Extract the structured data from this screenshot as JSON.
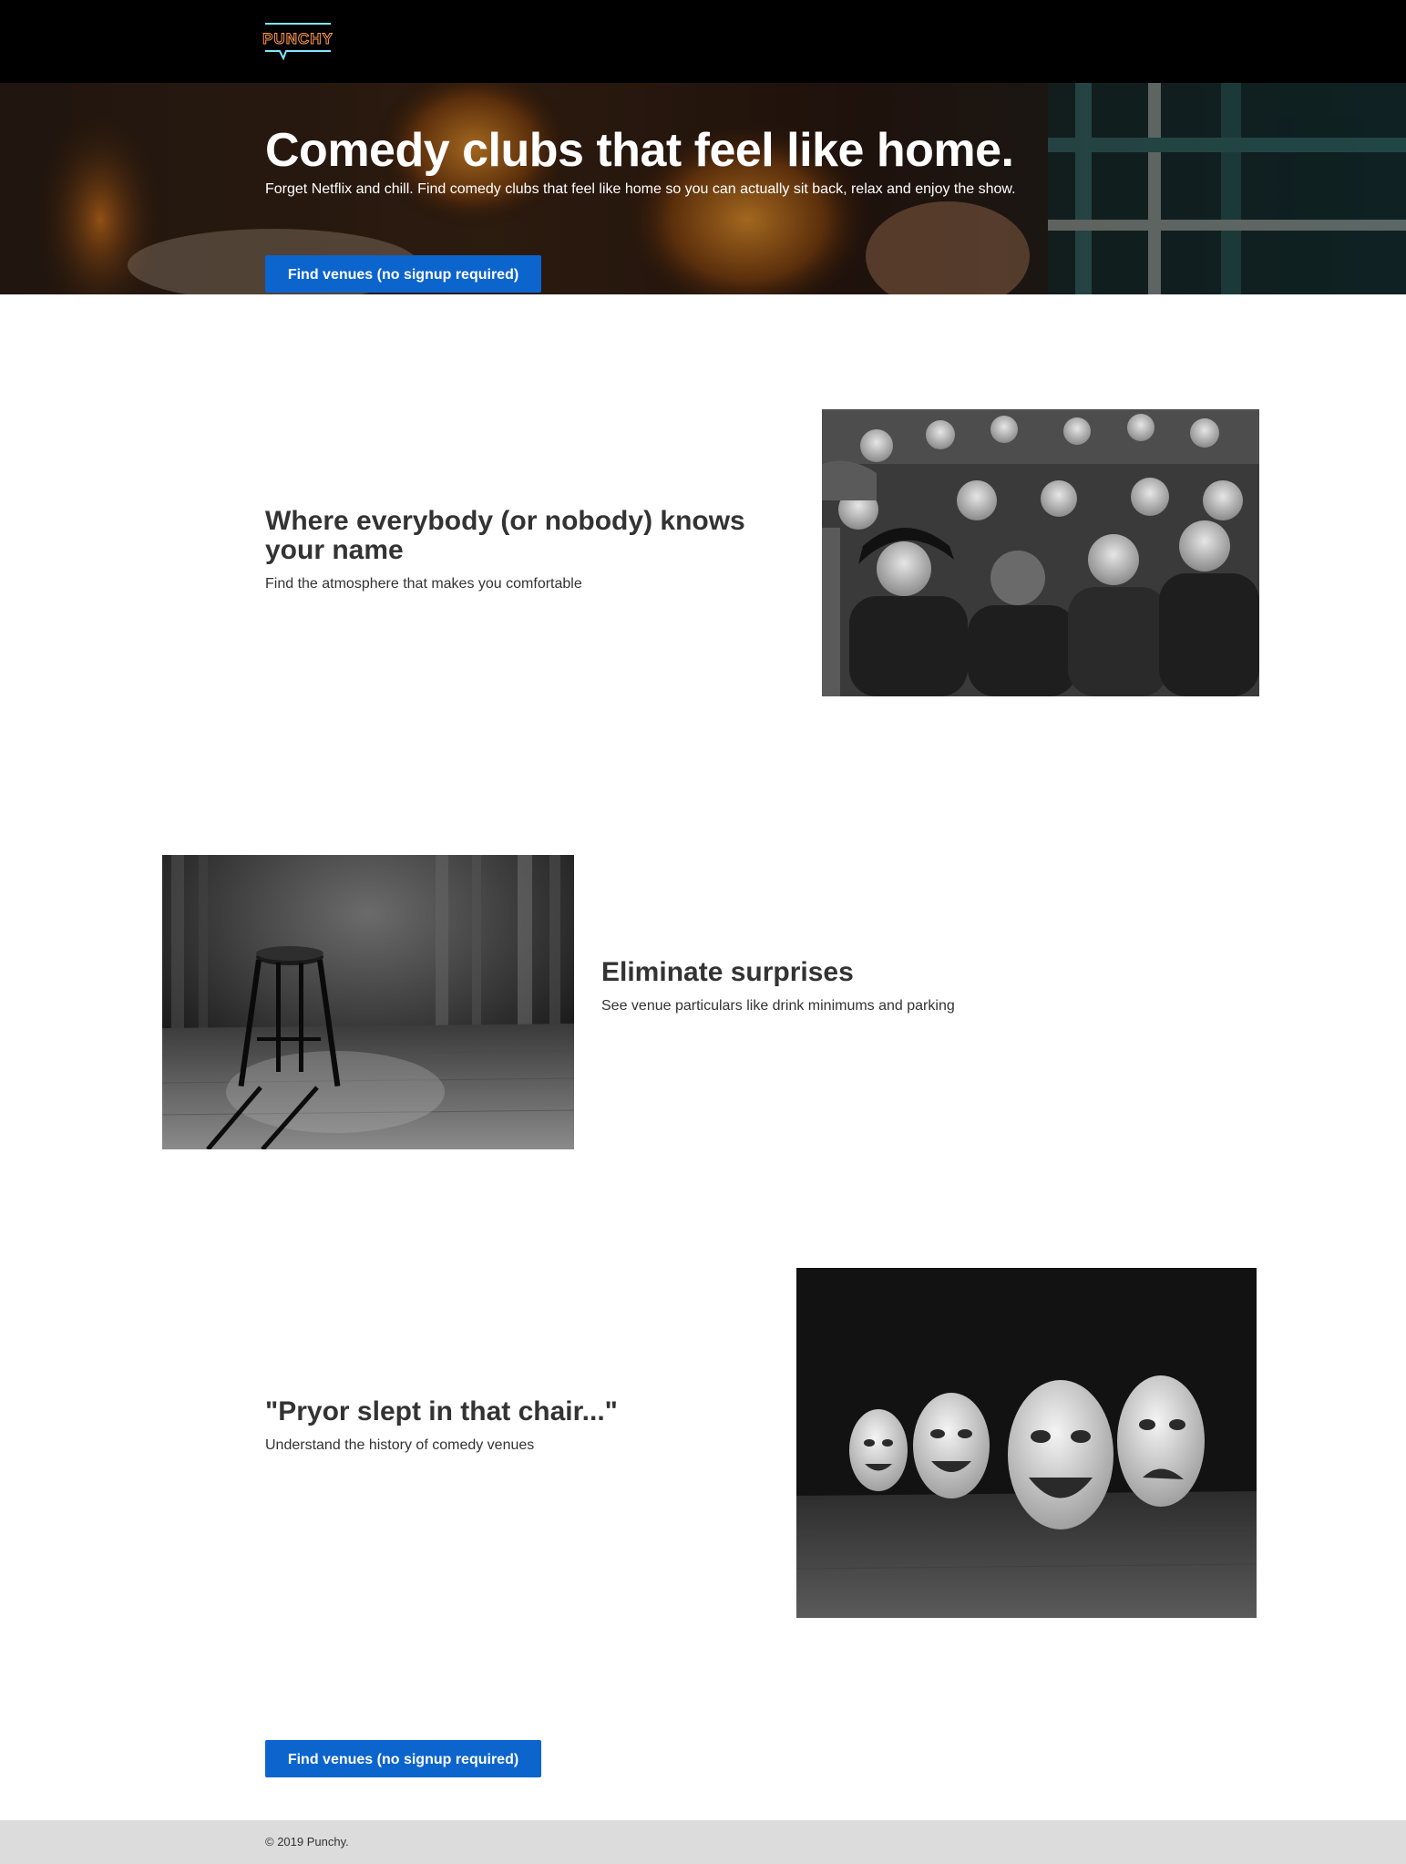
{
  "brand": {
    "logo_text": "PUNCHY"
  },
  "hero": {
    "title": "Comedy clubs that feel like home.",
    "subtitle": "Forget Netflix and chill. Find comedy clubs that feel like home so you can actually sit back, relax and enjoy the show.",
    "cta_label": "Find venues (no signup required)"
  },
  "features": [
    {
      "title": "Where everybody (or nobody) knows your name",
      "description": "Find the atmosphere that makes you comfortable"
    },
    {
      "title": "Eliminate surprises",
      "description": "See venue particulars like drink minimums and parking"
    },
    {
      "title": "\"Pryor slept in that chair...\"",
      "description": "Understand the history of comedy venues"
    }
  ],
  "bottom_cta": {
    "label": "Find venues (no signup required)"
  },
  "footer": {
    "copyright": "© 2019 Punchy."
  },
  "colors": {
    "topbar": "#000000",
    "primary_button": "#0c64cd",
    "footer_bg": "#dcdcdc",
    "text": "#333333",
    "logo_neon_cyan": "#7fe7ff",
    "logo_neon_orange": "#ff9a52"
  }
}
